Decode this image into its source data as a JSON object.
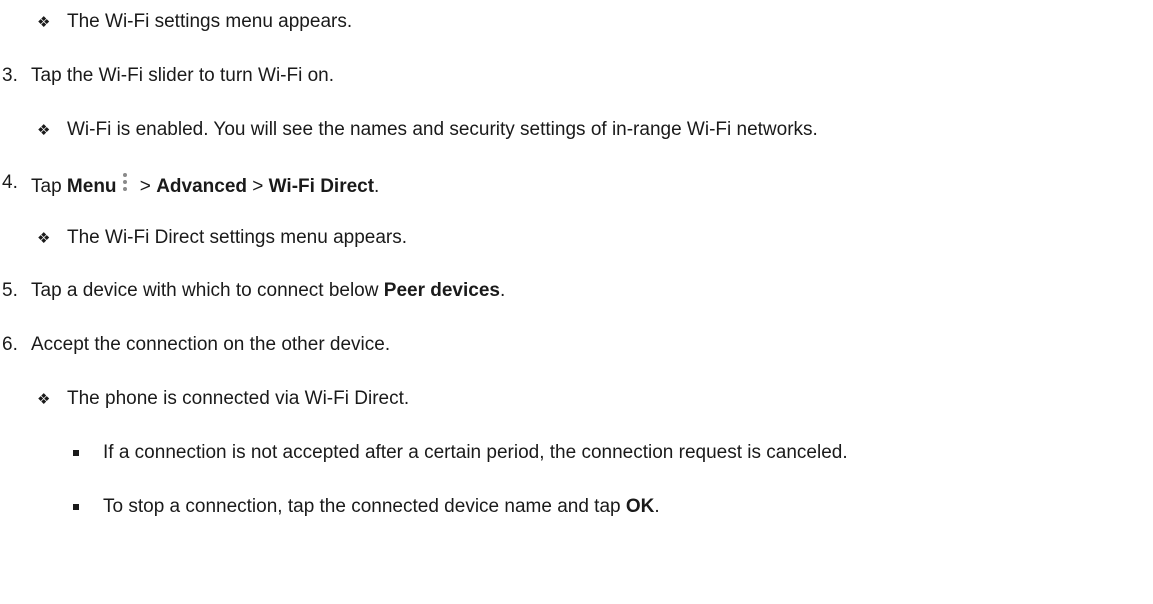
{
  "steps": {
    "b1": "The Wi-Fi settings menu appears.",
    "s3_num": "3.",
    "s3": "Tap the Wi-Fi slider to turn Wi-Fi on.",
    "b2": "Wi-Fi is enabled. You will see the names and security settings of in-range Wi-Fi networks.",
    "s4_num": "4.",
    "s4_tap": "Tap ",
    "s4_menu": "Menu",
    "s4_sep1": " > ",
    "s4_advanced": "Advanced",
    "s4_sep2": " > ",
    "s4_wifidirect": "Wi-Fi Direct",
    "s4_end": ".",
    "b3": "The Wi-Fi Direct settings menu appears.",
    "s5_num": "5.",
    "s5_text": "Tap a device with which to connect below ",
    "s5_bold": "Peer devices",
    "s5_end": ".",
    "s6_num": "6.",
    "s6": "Accept the connection on the other device.",
    "b4": "The phone is connected via Wi-Fi Direct.",
    "n1": "If a connection is not accepted after a certain period, the connection request is canceled.",
    "n2_text": "To stop a connection, tap the connected device name and tap ",
    "n2_bold": "OK",
    "n2_end": "."
  },
  "icons": {
    "diamond_bullet": "❖",
    "menu": "vertical-dots-menu-icon"
  }
}
